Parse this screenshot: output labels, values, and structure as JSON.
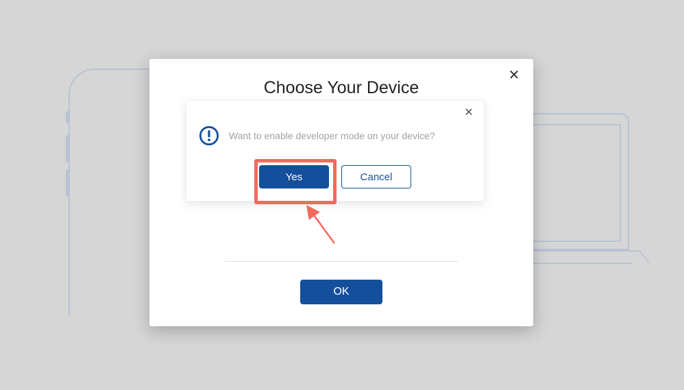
{
  "main_modal": {
    "title": "Choose Your Device",
    "close_glyph": "✕",
    "ok_label": "OK"
  },
  "confirm_modal": {
    "close_glyph": "✕",
    "message": "Want to enable developer mode on your device?",
    "yes_label": "Yes",
    "cancel_label": "Cancel"
  },
  "colors": {
    "primary": "#154f9c",
    "highlight": "#f16a5e"
  }
}
